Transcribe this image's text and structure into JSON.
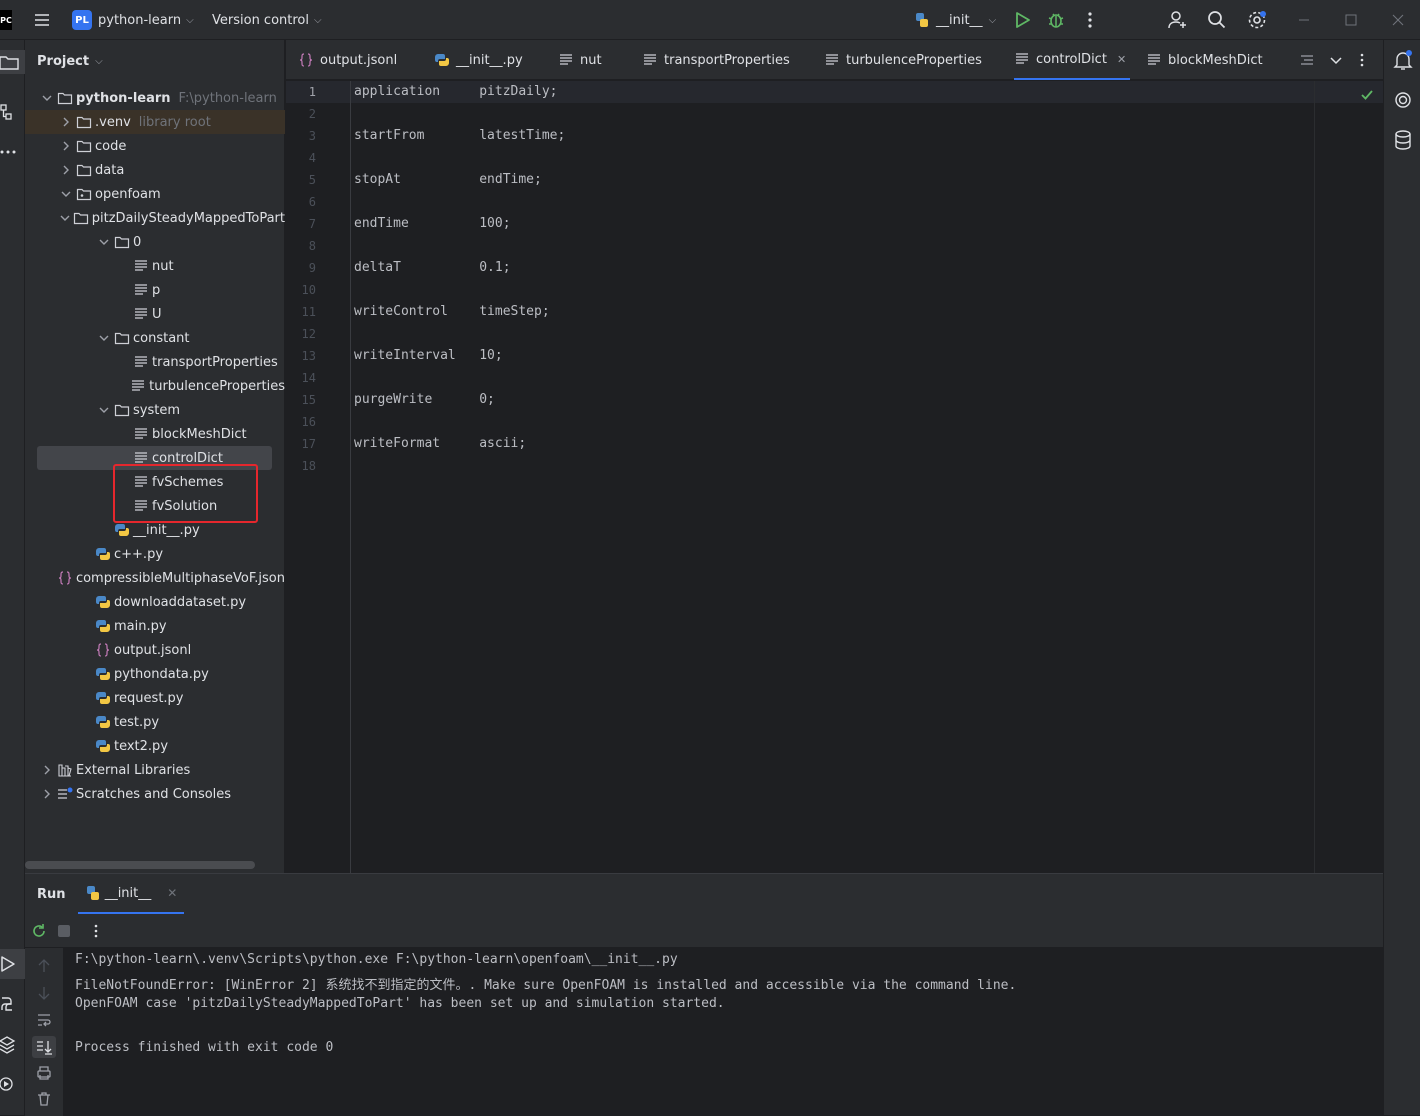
{
  "titlebar": {
    "app_badge": "PL",
    "project_name": "python-learn",
    "vcs_label": "Version control",
    "run_config": "__init__"
  },
  "project_panel": {
    "title": "Project",
    "tree": [
      {
        "label": "python-learn",
        "note": "F:\\python-learn",
        "icon": "folder-icon",
        "chevron": "down",
        "indent": 0,
        "bold": true
      },
      {
        "label": ".venv",
        "note": "library root",
        "icon": "folder-icon",
        "chevron": "right",
        "indent": 1
      },
      {
        "label": "code",
        "icon": "folder-icon",
        "chevron": "right",
        "indent": 1
      },
      {
        "label": "data",
        "icon": "folder-icon",
        "chevron": "right",
        "indent": 1
      },
      {
        "label": "openfoam",
        "icon": "package-folder-icon",
        "chevron": "down",
        "indent": 1
      },
      {
        "label": "pitzDailySteadyMappedToPart",
        "icon": "folder-icon",
        "chevron": "down",
        "indent": 2
      },
      {
        "label": "0",
        "icon": "folder-icon",
        "chevron": "down",
        "indent": 3
      },
      {
        "label": "nut",
        "icon": "text-file-icon",
        "indent": 4
      },
      {
        "label": "p",
        "icon": "text-file-icon",
        "indent": 4
      },
      {
        "label": "U",
        "icon": "text-file-icon",
        "indent": 4
      },
      {
        "label": "constant",
        "icon": "folder-icon",
        "chevron": "down",
        "indent": 3
      },
      {
        "label": "transportProperties",
        "icon": "text-file-icon",
        "indent": 4
      },
      {
        "label": "turbulenceProperties",
        "icon": "text-file-icon",
        "indent": 4
      },
      {
        "label": "system",
        "icon": "folder-icon",
        "chevron": "down",
        "indent": 3
      },
      {
        "label": "blockMeshDict",
        "icon": "text-file-icon",
        "indent": 4
      },
      {
        "label": "controlDict",
        "icon": "text-file-icon",
        "indent": 4,
        "selected": true
      },
      {
        "label": "fvSchemes",
        "icon": "text-file-icon",
        "indent": 4
      },
      {
        "label": "fvSolution",
        "icon": "text-file-icon",
        "indent": 4
      },
      {
        "label": "__init__.py",
        "icon": "python-file-icon",
        "indent": 3
      },
      {
        "label": "c++.py",
        "icon": "python-file-icon",
        "indent": 2
      },
      {
        "label": "compressibleMultiphaseVoF.json",
        "icon": "json-file-icon",
        "indent": 2
      },
      {
        "label": "downloaddataset.py",
        "icon": "python-file-icon",
        "indent": 2
      },
      {
        "label": "main.py",
        "icon": "python-file-icon",
        "indent": 2
      },
      {
        "label": "output.jsonl",
        "icon": "json-file-icon",
        "indent": 2
      },
      {
        "label": "pythondata.py",
        "icon": "python-file-icon",
        "indent": 2
      },
      {
        "label": "request.py",
        "icon": "python-file-icon",
        "indent": 2
      },
      {
        "label": "test.py",
        "icon": "python-file-icon",
        "indent": 2
      },
      {
        "label": "text2.py",
        "icon": "python-file-icon",
        "indent": 2
      },
      {
        "label": "External Libraries",
        "icon": "library-icon",
        "chevron": "right",
        "indent": 0
      },
      {
        "label": "Scratches and Consoles",
        "icon": "scratches-icon",
        "chevron": "right",
        "indent": 0
      }
    ]
  },
  "editor_tabs": [
    {
      "label": "output.jsonl",
      "icon": "json-file-icon"
    },
    {
      "label": "__init__.py",
      "icon": "python-file-icon"
    },
    {
      "label": "nut",
      "icon": "text-file-icon"
    },
    {
      "label": "transportProperties",
      "icon": "text-file-icon"
    },
    {
      "label": "turbulenceProperties",
      "icon": "text-file-icon"
    },
    {
      "label": "controlDict",
      "icon": "text-file-icon",
      "active": true
    },
    {
      "label": "blockMeshDict",
      "icon": "text-file-icon"
    }
  ],
  "editor": {
    "line_numbers": [
      "1",
      "2",
      "3",
      "4",
      "5",
      "6",
      "7",
      "8",
      "9",
      "10",
      "11",
      "12",
      "13",
      "14",
      "15",
      "16",
      "17",
      "18"
    ],
    "lines": [
      "application     pitzDaily;",
      "",
      "startFrom       latestTime;",
      "",
      "stopAt          endTime;",
      "",
      "endTime         100;",
      "",
      "deltaT          0.1;",
      "",
      "writeControl    timeStep;",
      "",
      "writeInterval   10;",
      "",
      "purgeWrite      0;",
      "",
      "writeFormat     ascii;",
      ""
    ]
  },
  "run_panel": {
    "title": "Run",
    "tab_label": "__init__",
    "console": [
      "F:\\python-learn\\.venv\\Scripts\\python.exe F:\\python-learn\\openfoam\\__init__.py",
      "FileNotFoundError: [WinError 2] 系统找不到指定的文件。. Make sure OpenFOAM is installed and accessible via the command line.",
      "OpenFOAM case 'pitzDailySteadyMappedToPart' has been set up and simulation started.",
      "",
      "Process finished with exit code 0"
    ]
  },
  "colors": {
    "accent": "#3574f0",
    "highlight_box": "#e5272d",
    "run_green": "#5fb865",
    "selection": "#43454a"
  }
}
